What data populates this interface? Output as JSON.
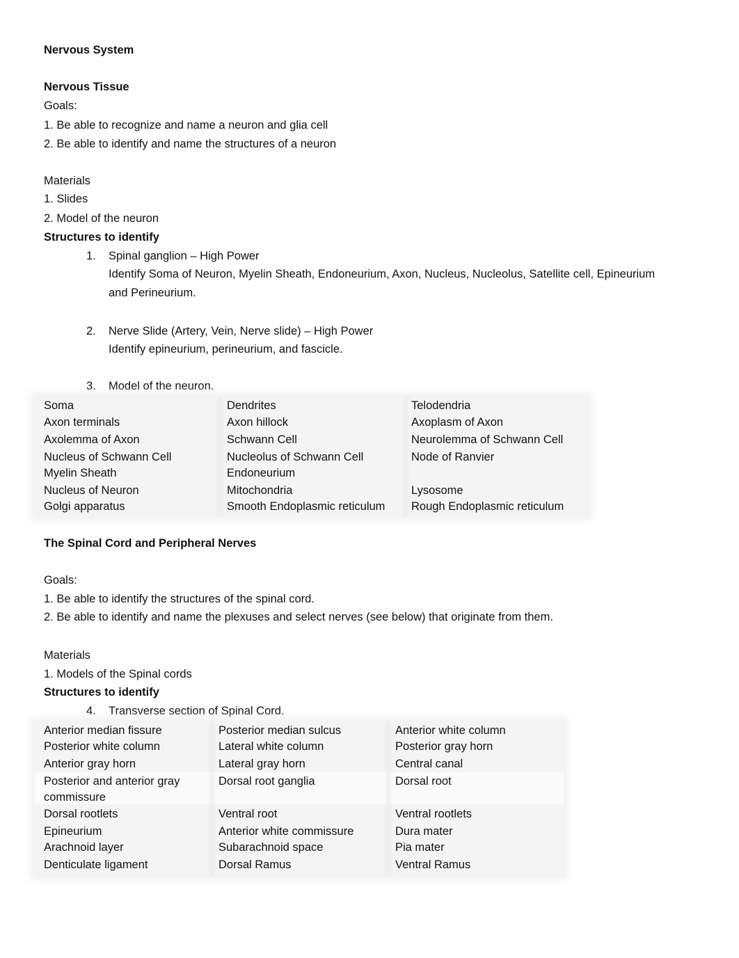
{
  "title": "Nervous System",
  "section1": {
    "heading": "Nervous Tissue",
    "goals_label": "Goals:",
    "goals": [
      "1. Be able to recognize and name a neuron and glia cell",
      "2. Be able to identify and name the structures of a neuron"
    ],
    "materials_label": "Materials",
    "materials": [
      "1. Slides",
      "2. Model of the neuron"
    ],
    "structures_label": "Structures to identify",
    "items": [
      {
        "num": "1.",
        "title": "Spinal ganglion – High Power",
        "desc_line1": "Identify Soma of Neuron, Myelin Sheath, Endoneurium, Axon, Nucleus, Nucleolus, Satellite cell, Epineurium",
        "desc_line2": "and Perineurium."
      },
      {
        "num": "2.",
        "title": "Nerve Slide (Artery, Vein, Nerve slide) – High Power",
        "desc_line1": "Identify epineurium, perineurium, and fascicle."
      },
      {
        "num": "3.",
        "title": "Model of the neuron."
      }
    ],
    "table": [
      [
        "Soma",
        "Dendrites",
        "Telodendria"
      ],
      [
        "Axon terminals",
        "Axon hillock",
        "Axoplasm of Axon"
      ],
      [
        "Axolemma of Axon",
        "Schwann Cell",
        "Neurolemma of Schwann Cell"
      ],
      [
        "Nucleus of Schwann Cell",
        "Nucleolus of Schwann Cell",
        "Node of Ranvier"
      ],
      [
        "Myelin Sheath",
        "Endoneurium",
        ""
      ],
      [
        "Nucleus of Neuron",
        "Mitochondria",
        "Lysosome"
      ],
      [
        "Golgi apparatus",
        "Smooth Endoplasmic reticulum",
        "Rough Endoplasmic reticulum"
      ]
    ]
  },
  "section2": {
    "heading": "The Spinal Cord and Peripheral Nerves",
    "goals_label": "Goals:",
    "goals": [
      "1. Be able to identify the structures of the spinal cord.",
      "2. Be able to identify and name the plexuses and select nerves (see below) that originate from them."
    ],
    "materials_label": "Materials",
    "materials": [
      "1. Models of the Spinal cords"
    ],
    "structures_label": "Structures to identify",
    "items": [
      {
        "num": "4.",
        "title": "Transverse section of Spinal Cord."
      }
    ],
    "table": [
      [
        "Anterior median fissure",
        "Posterior median sulcus",
        "Anterior white column"
      ],
      [
        "Posterior white column",
        "Lateral white column",
        "Posterior gray horn"
      ],
      [
        "Anterior gray horn",
        "Lateral gray horn",
        "Central canal"
      ],
      [
        "Posterior and anterior gray",
        "Dorsal root ganglia",
        "Dorsal root"
      ],
      [
        "commissure",
        "",
        ""
      ],
      [
        "Dorsal rootlets",
        "Ventral root",
        "Ventral rootlets"
      ],
      [
        "Epineurium",
        "Anterior white commissure",
        "Dura mater"
      ],
      [
        "Arachnoid layer",
        "Subarachnoid space",
        "Pia mater"
      ],
      [
        "Denticulate ligament",
        "Dorsal Ramus",
        "Ventral Ramus"
      ]
    ]
  }
}
